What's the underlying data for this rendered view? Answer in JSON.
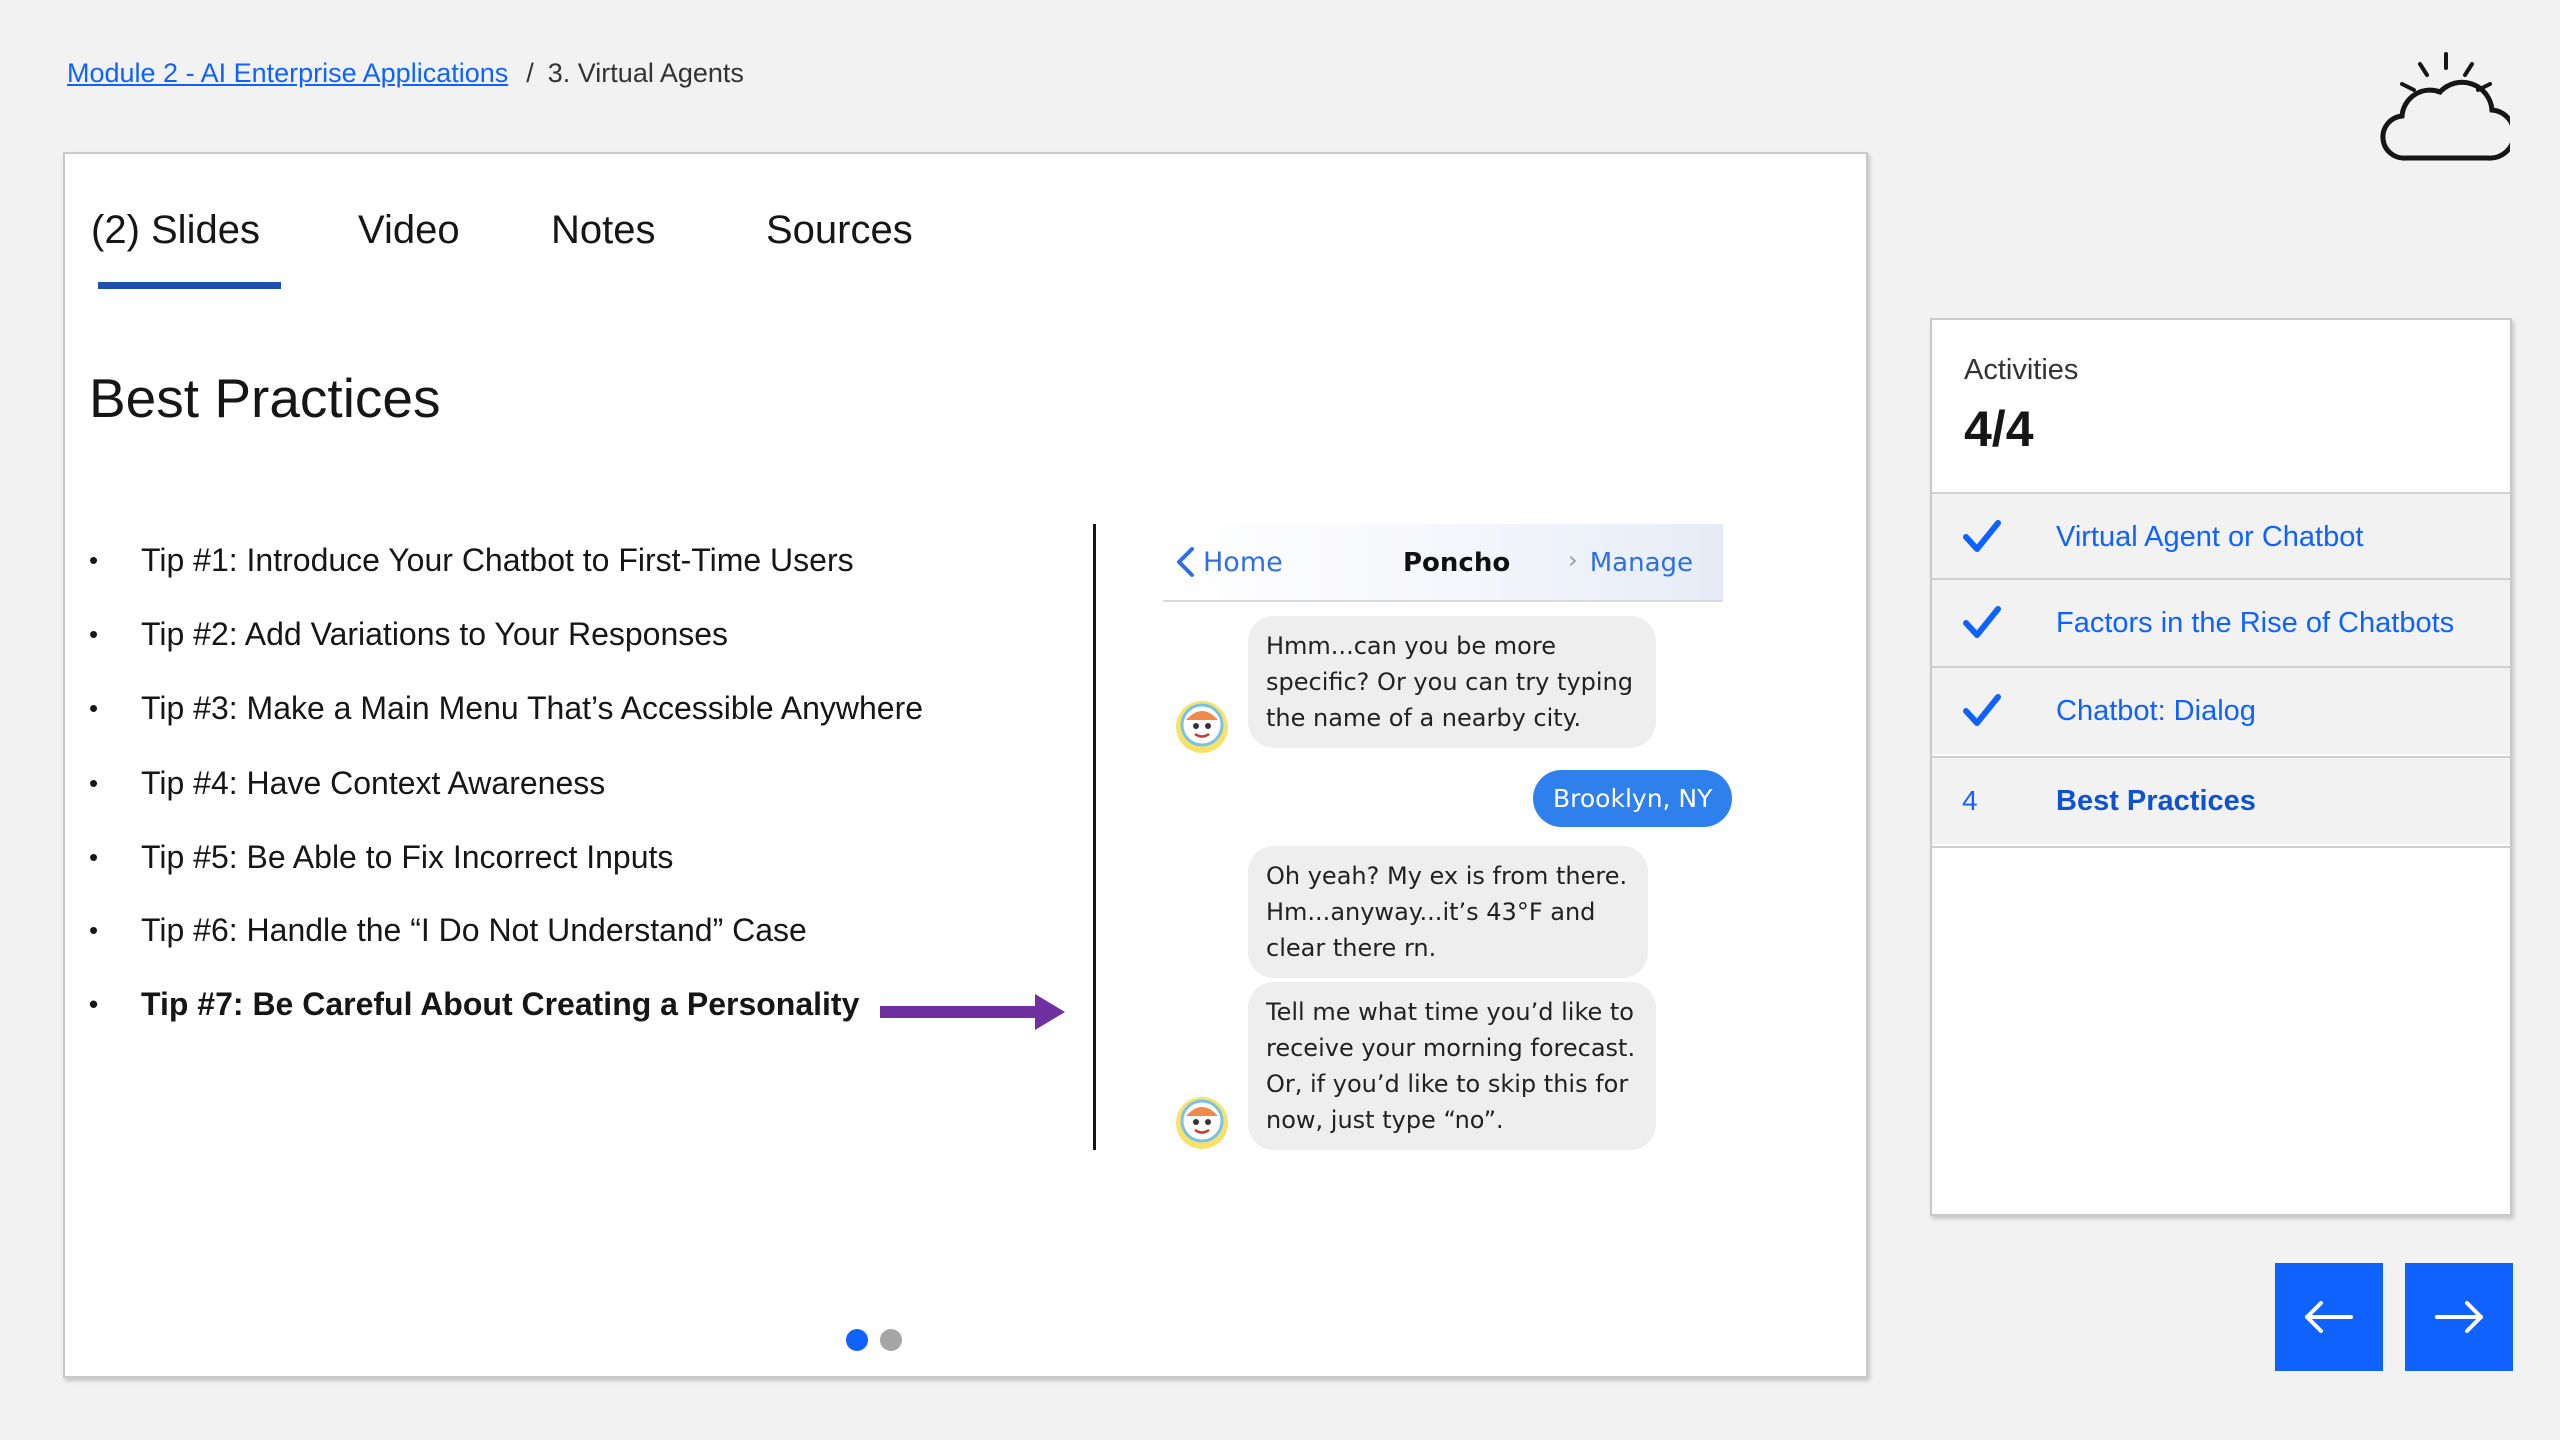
{
  "breadcrumb": {
    "module_link": "Module 2 - AI Enterprise Applications",
    "separator": "/",
    "current": "3. Virtual Agents"
  },
  "logo": {
    "icon": "sun-cloud-icon"
  },
  "tabs": [
    {
      "label": "(2) Slides",
      "active": true
    },
    {
      "label": "Video",
      "active": false
    },
    {
      "label": "Notes",
      "active": false
    },
    {
      "label": "Sources",
      "active": false
    }
  ],
  "slide": {
    "title": "Best Practices",
    "tips": [
      {
        "text": "Tip #1: Introduce Your Chatbot to First-Time Users",
        "highlighted": false
      },
      {
        "text": "Tip #2: Add Variations to Your Responses",
        "highlighted": false
      },
      {
        "text": "Tip #3: Make a Main Menu That’s Accessible Anywhere",
        "highlighted": false
      },
      {
        "text": "Tip #4: Have Context Awareness",
        "highlighted": false
      },
      {
        "text": "Tip #5: Be Able to Fix Incorrect Inputs",
        "highlighted": false
      },
      {
        "text": "Tip #6: Handle the “I Do Not Understand” Case",
        "highlighted": false
      },
      {
        "text": "Tip #7: Be Careful About Creating a Personality",
        "highlighted": true
      }
    ],
    "arrow_color": "#7030a0",
    "chat": {
      "back_label": "Home",
      "name": "Poncho",
      "name_chevron": "›",
      "manage_label": "Manage",
      "messages": [
        {
          "from": "bot",
          "text": "Hmm...can you be more\nspecific? Or you can try typing\nthe name of a nearby city."
        },
        {
          "from": "user",
          "text": "Brooklyn, NY"
        },
        {
          "from": "bot",
          "text": "Oh yeah? My ex is from there.\nHm...anyway...it’s 43°F and\nclear there rn."
        },
        {
          "from": "bot",
          "text": "Tell me what time you’d like to\nreceive your morning forecast.\nOr, if you’d like to skip this for\nnow, just type “no”."
        }
      ]
    },
    "pagination": {
      "total": 2,
      "current": 1
    }
  },
  "activities": {
    "label": "Activities",
    "count": "4/4",
    "items": [
      {
        "marker": "check",
        "label": "Virtual Agent or Chatbot",
        "current": false
      },
      {
        "marker": "check",
        "label": "Factors in the Rise of Chatbots",
        "current": false
      },
      {
        "marker": "check",
        "label": "Chatbot: Dialog",
        "current": false
      },
      {
        "marker": "4",
        "label": "Best Practices",
        "current": true
      }
    ]
  },
  "nav": {
    "prev_icon": "arrow-left-icon",
    "next_icon": "arrow-right-icon"
  },
  "colors": {
    "accent": "#0f62fe",
    "tab_underline": "#1f4fb0",
    "imessage_blue": "#2f80ed"
  }
}
